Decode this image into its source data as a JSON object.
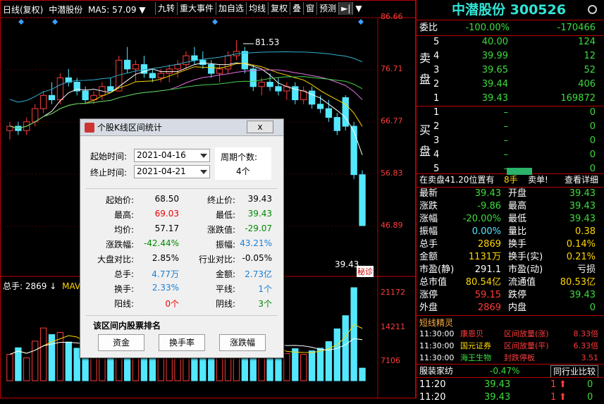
{
  "chart_header": {
    "mode": "日线(复权)",
    "name": "中潜股份",
    "ma": "MA5: 57.09",
    "arrow": "▼"
  },
  "toolbar": [
    "九转",
    "重大事件",
    "加自选",
    "均线",
    "复权",
    "叠",
    "窗",
    "预测"
  ],
  "toolbar_icons": {
    "jump": "►|",
    "more": "▼"
  },
  "price_axis": [
    "86.66",
    "76.71",
    "66.77",
    "56.83",
    "46.89"
  ],
  "volume_axis": [
    "21172",
    "14211",
    "7106"
  ],
  "peak_label": "81.53",
  "last_price_label": "39.43",
  "tip_tag": "秘诊",
  "volume_header": {
    "text": "总手: 2869",
    "arrow": "↓",
    "ma": "MAVO"
  },
  "dialog": {
    "title": "个股K线区间统计",
    "close": "x",
    "start_label": "起始时间:",
    "start_value": "2021-04-16",
    "end_label": "终止时间:",
    "end_value": "2021-04-21",
    "period_label": "周期个数:",
    "period_value": "4个",
    "stats": [
      {
        "l": "起始价:",
        "v": "68.50",
        "c": "k",
        "l2": "终止价:",
        "v2": "39.43",
        "c2": "k"
      },
      {
        "l": "最高:",
        "v": "69.03",
        "c": "r",
        "l2": "最低:",
        "v2": "39.43",
        "c2": "g"
      },
      {
        "l": "均价:",
        "v": "57.17",
        "c": "k",
        "l2": "涨跌值:",
        "v2": "-29.07",
        "c2": "g"
      },
      {
        "l": "涨跌幅:",
        "v": "-42.44%",
        "c": "g",
        "l2": "振幅:",
        "v2": "43.21%",
        "c2": "b"
      },
      {
        "l": "大盘对比:",
        "v": "2.85%",
        "c": "k",
        "l2": "行业对比:",
        "v2": "-0.05%",
        "c2": "k"
      },
      {
        "l": "总手:",
        "v": "4.77万",
        "c": "b",
        "l2": "金额:",
        "v2": "2.73亿",
        "c2": "b"
      },
      {
        "l": "换手:",
        "v": "2.33%",
        "c": "b",
        "l2": "平线:",
        "v2": "1个",
        "c2": "b"
      },
      {
        "l": "阳线:",
        "v": "0个",
        "c": "r",
        "l2": "阴线:",
        "v2": "3个",
        "c2": "g"
      }
    ],
    "rank_title": "该区间内股票排名",
    "buttons": [
      "资金",
      "换手率",
      "涨跌幅"
    ]
  },
  "quote": {
    "title": "中潜股份 300526",
    "settings_icon": "gear-icon",
    "weibi": {
      "label": "委比",
      "pct": "-100.00%",
      "diff": "-170466"
    },
    "sell_label": "卖盘",
    "buy_label": "买盘",
    "sell": [
      {
        "n": "5",
        "p": "40.00",
        "v": "124"
      },
      {
        "n": "4",
        "p": "39.99",
        "v": "12"
      },
      {
        "n": "3",
        "p": "39.65",
        "v": "52"
      },
      {
        "n": "2",
        "p": "39.44",
        "v": "406"
      },
      {
        "n": "1",
        "p": "39.43",
        "v": "169872"
      }
    ],
    "buy": [
      {
        "n": "1",
        "p": "–",
        "v": "0"
      },
      {
        "n": "2",
        "p": "–",
        "v": "0"
      },
      {
        "n": "3",
        "p": "–",
        "v": "0"
      },
      {
        "n": "4",
        "p": "–",
        "v": "0"
      },
      {
        "n": "5",
        "p": "–",
        "v": "0"
      }
    ],
    "notice": {
      "text": "在卖盘41.20位置有",
      "qty": "8手",
      "action": "卖单!",
      "detail": "查看详细"
    },
    "fields": [
      {
        "l": "最新",
        "v": "39.43",
        "c": "g",
        "l2": "开盘",
        "v2": "39.43",
        "c2": "g"
      },
      {
        "l": "涨跌",
        "v": "-9.86",
        "c": "g",
        "l2": "最高",
        "v2": "39.43",
        "c2": "g"
      },
      {
        "l": "涨幅",
        "v": "-20.00%",
        "c": "g",
        "l2": "最低",
        "v2": "39.43",
        "c2": "g"
      },
      {
        "l": "振幅",
        "v": "0.00%",
        "c": "c",
        "l2": "量比",
        "v2": "0.38",
        "c2": "y"
      },
      {
        "l": "总手",
        "v": "2869",
        "c": "y",
        "l2": "换手",
        "v2": "0.14%",
        "c2": "y"
      },
      {
        "l": "金额",
        "v": "1131万",
        "c": "y",
        "l2": "换手(实)",
        "v2": "0.21%",
        "c2": "y"
      },
      {
        "l": "市盈(静)",
        "v": "291.1",
        "c": "w",
        "l2": "市盈(动)",
        "v2": "亏损",
        "c2": "w"
      },
      {
        "l": "总市值",
        "v": "80.54亿",
        "c": "y",
        "l2": "流通值",
        "v2": "80.53亿",
        "c2": "y"
      },
      {
        "l": "涨停",
        "v": "59.15",
        "c": "r",
        "l2": "跌停",
        "v2": "39.43",
        "c2": "g"
      },
      {
        "l": "外盘",
        "v": "2869",
        "c": "r",
        "l2": "内盘",
        "v2": "0",
        "c2": "g"
      }
    ],
    "short": {
      "title": "短线精灵",
      "rows": [
        {
          "t": "11:30:00",
          "n": "康恩贝",
          "e": "区间放量(涨)",
          "v": "8.33倍",
          "nc": "r"
        },
        {
          "t": "11:30:00",
          "n": "国元证券",
          "e": "区间放量(平)",
          "v": "6.33倍",
          "nc": "y"
        },
        {
          "t": "11:30:00",
          "n": "海王生物",
          "e": "封跌停板",
          "v": "3.51",
          "nc": "g"
        }
      ]
    },
    "industry": {
      "name": "服装家纺",
      "pct": "-0.47%",
      "cmp": "同行业比较"
    },
    "ticks": [
      {
        "t": "11:20",
        "p": "39.43",
        "v": "1"
      },
      {
        "t": "11:20",
        "p": "39.43",
        "v": "1"
      }
    ]
  },
  "chart_data": {
    "type": "candlestick",
    "ylim": [
      39.43,
      86.66
    ],
    "candles": [
      [
        61,
        63,
        59,
        62
      ],
      [
        62,
        63,
        60,
        61
      ],
      [
        61,
        64,
        60,
        63
      ],
      [
        63,
        67,
        62,
        66
      ],
      [
        66,
        70,
        65,
        69
      ],
      [
        69,
        72,
        67,
        68
      ],
      [
        68,
        74,
        67,
        73
      ],
      [
        73,
        75,
        71,
        72
      ],
      [
        72,
        73,
        69,
        70
      ],
      [
        70,
        71,
        67,
        68
      ],
      [
        68,
        70,
        67,
        69
      ],
      [
        69,
        72,
        68,
        71
      ],
      [
        71,
        73,
        70,
        70
      ],
      [
        70,
        78,
        70,
        77
      ],
      [
        77,
        80,
        74,
        75
      ],
      [
        75,
        77,
        72,
        76
      ],
      [
        76,
        78,
        73,
        74
      ],
      [
        74,
        75,
        72,
        73
      ],
      [
        73,
        75,
        72,
        74
      ],
      [
        74,
        76,
        72,
        75
      ],
      [
        75,
        77,
        73,
        76
      ],
      [
        76,
        79,
        75,
        78
      ],
      [
        78,
        80,
        76,
        77
      ],
      [
        77,
        79,
        75,
        76
      ],
      [
        76,
        77,
        73,
        74
      ],
      [
        74,
        76,
        72,
        75
      ],
      [
        75,
        79,
        74,
        78
      ],
      [
        78,
        81.53,
        77,
        79
      ],
      [
        79,
        80,
        74,
        75
      ],
      [
        75,
        76,
        70,
        71
      ],
      [
        71,
        73,
        69,
        72
      ],
      [
        72,
        74,
        70,
        71
      ],
      [
        71,
        73,
        69,
        70
      ],
      [
        70,
        72,
        68,
        71
      ],
      [
        71,
        72,
        67,
        68
      ],
      [
        68,
        71,
        67,
        70
      ],
      [
        70,
        71,
        66,
        67
      ],
      [
        67,
        69,
        65,
        66
      ],
      [
        66,
        68,
        63,
        64
      ],
      [
        64,
        65,
        60,
        61
      ],
      [
        68.5,
        69.03,
        61,
        62
      ],
      [
        62,
        63,
        50,
        51
      ],
      [
        51,
        52,
        39.43,
        39.43
      ]
    ],
    "volumes": [
      6000,
      7500,
      5200,
      9000,
      12000,
      10500,
      11000,
      8800,
      7400,
      6800,
      5600,
      7900,
      6100,
      13000,
      11200,
      9000,
      8200,
      7000,
      6600,
      7200,
      7700,
      9500,
      8600,
      7900,
      6900,
      7100,
      9800,
      12500,
      10200,
      8100,
      6400,
      6900,
      5800,
      6200,
      7300,
      6000,
      6800,
      7400,
      8900,
      11800,
      14800,
      21172,
      2869
    ]
  }
}
